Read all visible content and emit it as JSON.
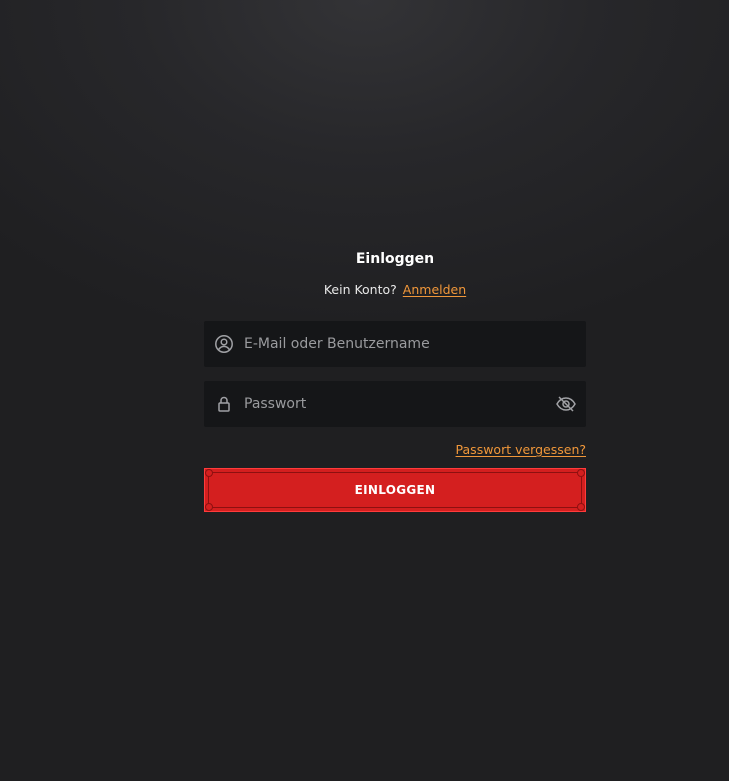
{
  "login": {
    "title": "Einloggen",
    "no_account_text": "Kein Konto?",
    "signup_link": "Anmelden",
    "email_placeholder": "E-Mail oder Benutzername",
    "password_placeholder": "Passwort",
    "forgot_password_link": "Passwort vergessen?",
    "submit_label": "EINLOGGEN"
  },
  "icons": {
    "email_field": "user-circle-icon",
    "password_field": "lock-icon",
    "password_toggle": "eye-off-icon"
  },
  "colors": {
    "accent_link": "#f0973a",
    "button": "#d41f1f",
    "input_bg": "#151618",
    "background": "#27272a"
  }
}
